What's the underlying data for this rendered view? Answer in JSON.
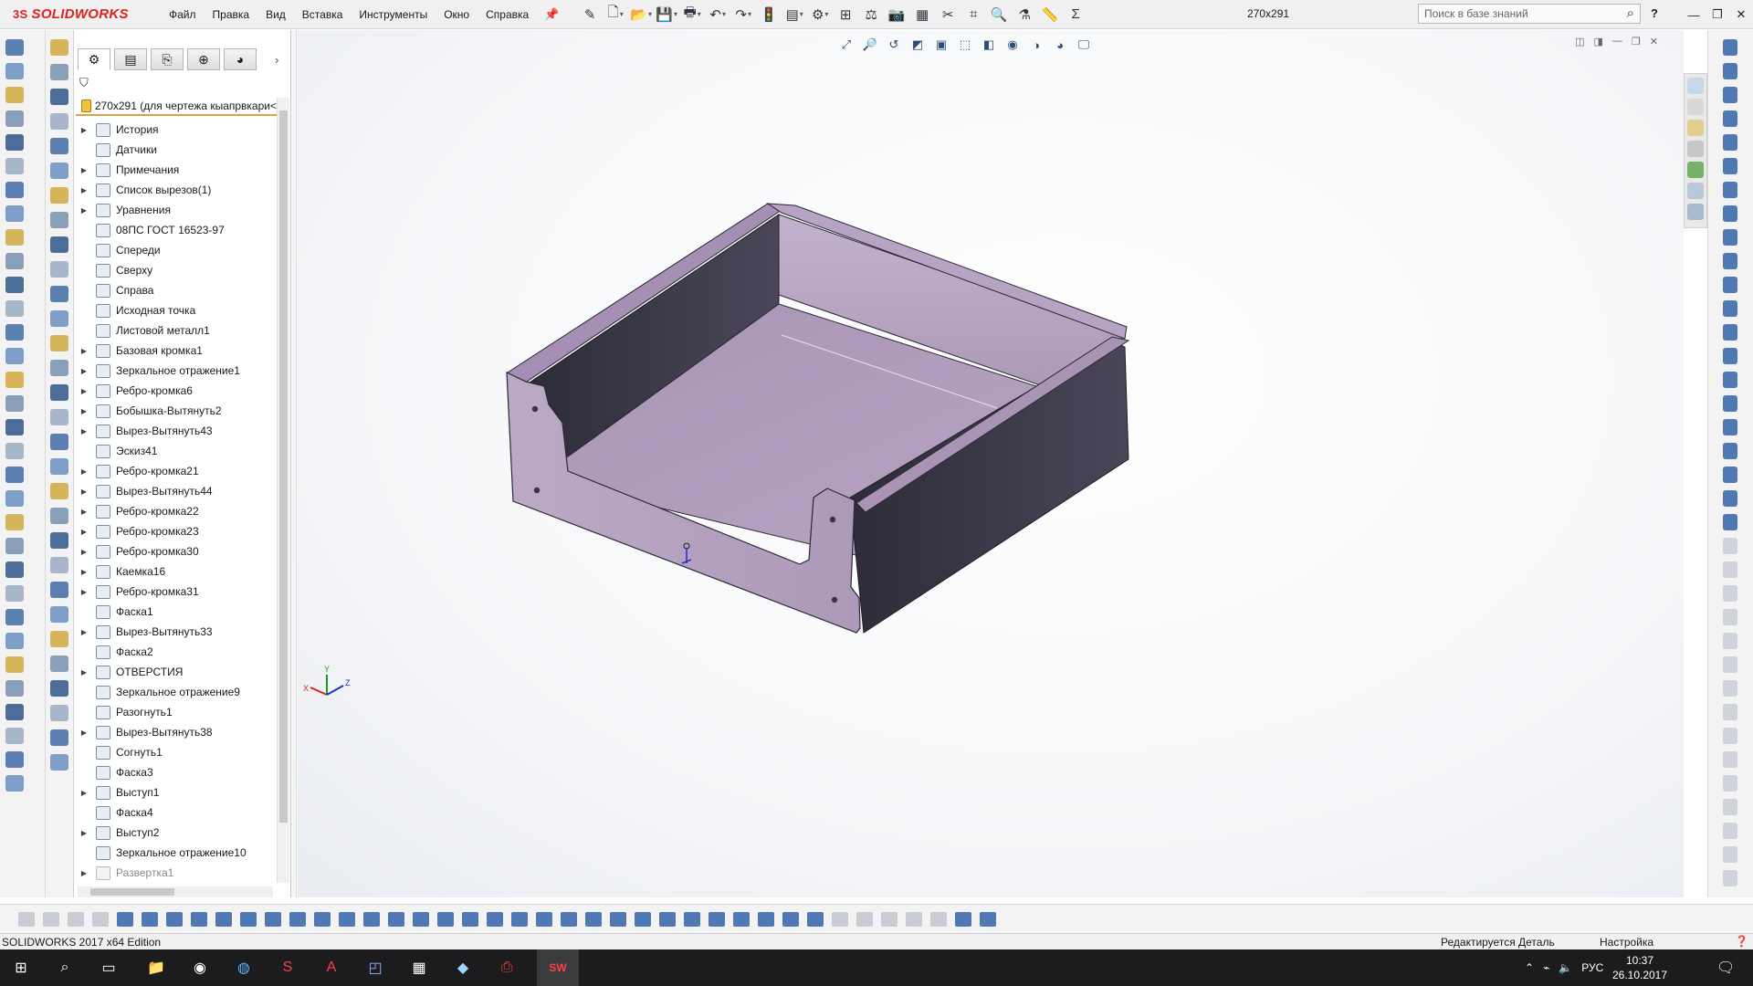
{
  "app": {
    "logo_text": "SOLIDWORKS",
    "logo_mark": "3S",
    "document_title": "270x291"
  },
  "menu": [
    "Файл",
    "Правка",
    "Вид",
    "Вставка",
    "Инструменты",
    "Окно",
    "Справка"
  ],
  "search": {
    "placeholder": "Поиск в базе знаний"
  },
  "help": "?",
  "feature_manager": {
    "root_label": "270x291  (для чертежа кыапрвкари<",
    "items": [
      {
        "label": "История",
        "expandable": true
      },
      {
        "label": "Датчики",
        "expandable": false
      },
      {
        "label": "Примечания",
        "expandable": true
      },
      {
        "label": "Список вырезов(1)",
        "expandable": true
      },
      {
        "label": "Уравнения",
        "expandable": true
      },
      {
        "label": "08ПС ГОСТ 16523-97",
        "expandable": false
      },
      {
        "label": "Спереди",
        "expandable": false
      },
      {
        "label": "Сверху",
        "expandable": false
      },
      {
        "label": "Справа",
        "expandable": false
      },
      {
        "label": "Исходная точка",
        "expandable": false
      },
      {
        "label": "Листовой металл1",
        "expandable": false
      },
      {
        "label": "Базовая кромка1",
        "expandable": true
      },
      {
        "label": "Зеркальное отражение1",
        "expandable": true
      },
      {
        "label": "Ребро-кромка6",
        "expandable": true
      },
      {
        "label": "Бобышка-Вытянуть2",
        "expandable": true
      },
      {
        "label": "Вырез-Вытянуть43",
        "expandable": true
      },
      {
        "label": "Эскиз41",
        "expandable": false
      },
      {
        "label": "Ребро-кромка21",
        "expandable": true
      },
      {
        "label": "Вырез-Вытянуть44",
        "expandable": true
      },
      {
        "label": "Ребро-кромка22",
        "expandable": true
      },
      {
        "label": "Ребро-кромка23",
        "expandable": true
      },
      {
        "label": "Ребро-кромка30",
        "expandable": true
      },
      {
        "label": "Каемка16",
        "expandable": true
      },
      {
        "label": "Ребро-кромка31",
        "expandable": true
      },
      {
        "label": "Фаска1",
        "expandable": false
      },
      {
        "label": "Вырез-Вытянуть33",
        "expandable": true
      },
      {
        "label": "Фаска2",
        "expandable": false
      },
      {
        "label": "ОТВЕРСТИЯ",
        "expandable": true
      },
      {
        "label": "Зеркальное отражение9",
        "expandable": false
      },
      {
        "label": "Разогнуть1",
        "expandable": false
      },
      {
        "label": "Вырез-Вытянуть38",
        "expandable": true
      },
      {
        "label": "Согнуть1",
        "expandable": false
      },
      {
        "label": "Фаска3",
        "expandable": false
      },
      {
        "label": "Выступ1",
        "expandable": true
      },
      {
        "label": "Фаска4",
        "expandable": false
      },
      {
        "label": "Выступ2",
        "expandable": true
      },
      {
        "label": "Зеркальное отражение10",
        "expandable": false
      },
      {
        "label": "Развертка1",
        "expandable": true,
        "suppressed": true
      }
    ]
  },
  "triad": {
    "x": "X",
    "y": "Y",
    "z": "Z"
  },
  "status": {
    "edition": "SOLIDWORKS 2017 x64 Edition",
    "editing": "Редактируется Деталь",
    "customize": "Настройка"
  },
  "taskbar": {
    "lang": "РУС",
    "time": "10:37",
    "date": "26.10.2017",
    "sw_badge": "SW"
  },
  "colors": {
    "model_face": "#b09cba",
    "model_top": "#a68fb4",
    "model_wall": "#3d3b4a",
    "accent": "#d22222"
  }
}
